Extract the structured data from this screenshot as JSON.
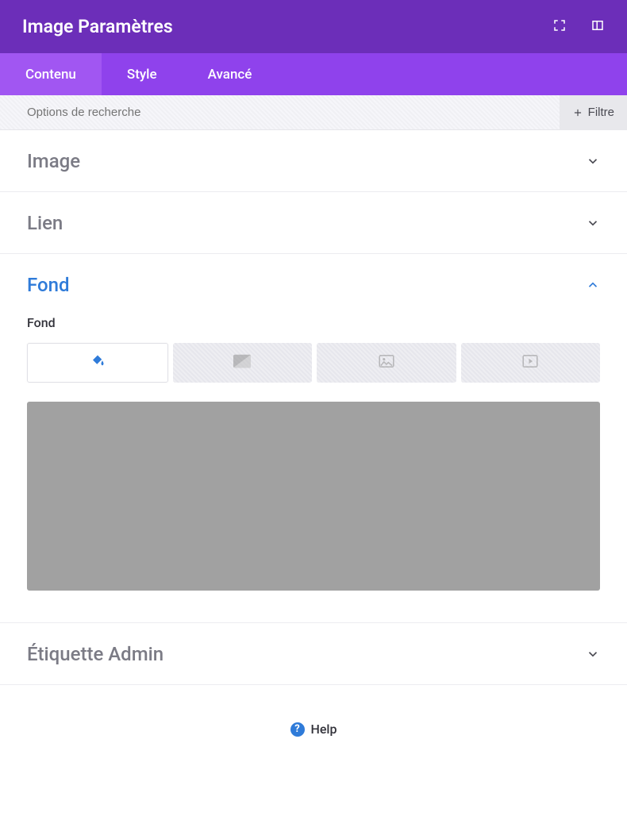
{
  "header": {
    "title": "Image Paramètres"
  },
  "tabs": [
    {
      "label": "Contenu",
      "active": true
    },
    {
      "label": "Style",
      "active": false
    },
    {
      "label": "Avancé",
      "active": false
    }
  ],
  "search": {
    "placeholder": "Options de recherche",
    "filter_label": "Filtre"
  },
  "sections": {
    "image": {
      "title": "Image",
      "expanded": false
    },
    "lien": {
      "title": "Lien",
      "expanded": false
    },
    "fond": {
      "title": "Fond",
      "expanded": true,
      "field_label": "Fond",
      "bg_options": [
        {
          "name": "color",
          "active": true
        },
        {
          "name": "gradient",
          "active": false
        },
        {
          "name": "image",
          "active": false
        },
        {
          "name": "video",
          "active": false
        }
      ]
    },
    "etiquette": {
      "title": "Étiquette Admin",
      "expanded": false
    }
  },
  "help": {
    "label": "Help"
  }
}
